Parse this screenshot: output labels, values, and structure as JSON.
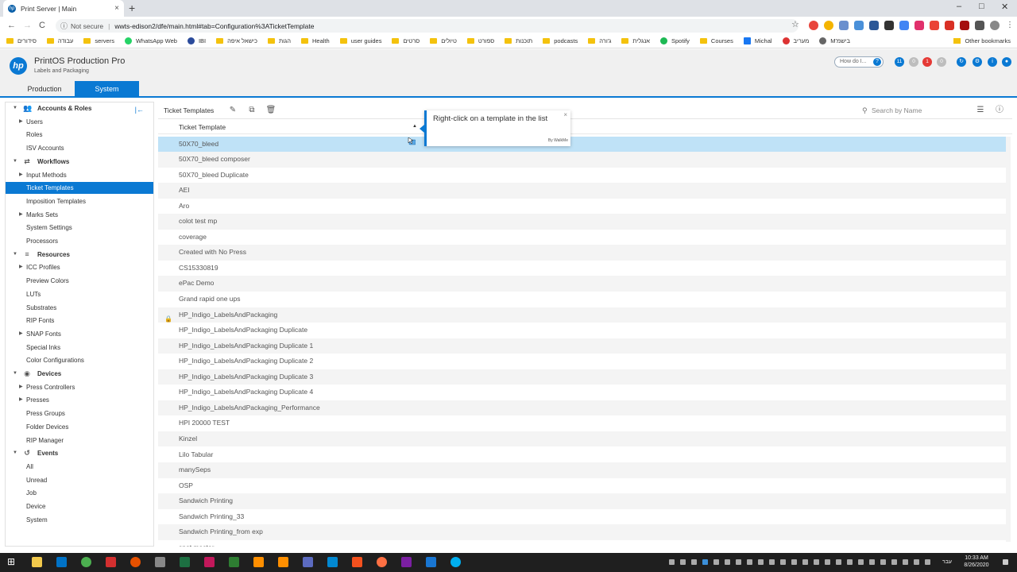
{
  "browser": {
    "tab_title": "Print Server | Main",
    "tab_favicon": "hp",
    "tab_close": "×",
    "new_tab": "+",
    "window_controls": [
      "–",
      "□",
      "✕"
    ],
    "security_label": "Not secure",
    "url": "wwts-edison2/dfe/main.html#tab=Configuration%3ATicketTemplate",
    "nav": [
      "←",
      "→",
      "C"
    ],
    "bookmark_star": "☆",
    "bookmarks": [
      "סידורים",
      "עבודה",
      "servers",
      "WhatsApp Web",
      "IBI",
      "כישאל איפה",
      "הגות",
      "Health",
      "user guides",
      "סרטים",
      "טיולים",
      "ספורט",
      "תוכנות",
      "podcasts",
      "ג'ורה",
      "אנגלית",
      "Spotify",
      "Courses",
      "Michal",
      "מעריב",
      "M'בישמ"
    ],
    "other_bookmarks": "Other bookmarks"
  },
  "app": {
    "logo": "hp",
    "title": "PrintOS Production Pro",
    "subtitle": "Labels and Packaging",
    "how_do_i": "How do I...",
    "help_glyph": "?",
    "badges": [
      {
        "count": "11",
        "color": "#0a79d3"
      },
      {
        "count": "0",
        "color": "#bdbdbd"
      },
      {
        "count": "1",
        "color": "#e53935"
      },
      {
        "count": "0",
        "color": "#bdbdbd"
      }
    ],
    "tabs": {
      "production": "Production",
      "system": "System"
    }
  },
  "sidebar": {
    "collapse_glyph": "|←",
    "items": [
      {
        "label": "Accounts & Roles",
        "type": "section",
        "icon": "users-icon",
        "glyph": "👥"
      },
      {
        "label": "Users",
        "type": "expandable"
      },
      {
        "label": "Roles",
        "type": "leaf"
      },
      {
        "label": "ISV Accounts",
        "type": "leaf"
      },
      {
        "label": "Workflows",
        "type": "section",
        "icon": "workflow-icon",
        "glyph": "⇄"
      },
      {
        "label": "Input Methods",
        "type": "expandable"
      },
      {
        "label": "Ticket Templates",
        "type": "leaf",
        "selected": true
      },
      {
        "label": "Imposition Templates",
        "type": "leaf"
      },
      {
        "label": "Marks Sets",
        "type": "expandable"
      },
      {
        "label": "System Settings",
        "type": "leaf"
      },
      {
        "label": "Processors",
        "type": "leaf"
      },
      {
        "label": "Resources",
        "type": "section",
        "icon": "database-icon",
        "glyph": "≡"
      },
      {
        "label": "ICC Profiles",
        "type": "expandable"
      },
      {
        "label": "Preview Colors",
        "type": "leaf"
      },
      {
        "label": "LUTs",
        "type": "leaf"
      },
      {
        "label": "Substrates",
        "type": "leaf"
      },
      {
        "label": "RIP Fonts",
        "type": "leaf"
      },
      {
        "label": "SNAP Fonts",
        "type": "expandable"
      },
      {
        "label": "Special Inks",
        "type": "leaf"
      },
      {
        "label": "Color Configurations",
        "type": "leaf"
      },
      {
        "label": "Devices",
        "type": "section",
        "icon": "devices-icon",
        "glyph": "◉"
      },
      {
        "label": "Press Controllers",
        "type": "expandable"
      },
      {
        "label": "Presses",
        "type": "expandable"
      },
      {
        "label": "Press Groups",
        "type": "leaf"
      },
      {
        "label": "Folder Devices",
        "type": "leaf"
      },
      {
        "label": "RIP Manager",
        "type": "leaf"
      },
      {
        "label": "Events",
        "type": "section",
        "icon": "history-icon",
        "glyph": "↺"
      },
      {
        "label": "All",
        "type": "leaf"
      },
      {
        "label": "Unread",
        "type": "leaf"
      },
      {
        "label": "Job",
        "type": "leaf"
      },
      {
        "label": "Device",
        "type": "leaf"
      },
      {
        "label": "System",
        "type": "leaf"
      }
    ]
  },
  "main": {
    "title": "Ticket Templates",
    "toolbar_glyphs": {
      "edit": "✎",
      "duplicate": "⧉",
      "delete": "🗑"
    },
    "search_placeholder": "Search by Name",
    "search_glyph": "⚲",
    "column_header": "Ticket Template",
    "rows": [
      {
        "name": "50X70_bleed",
        "selected": true
      },
      {
        "name": "50X70_bleed composer"
      },
      {
        "name": "50X70_bleed Duplicate"
      },
      {
        "name": "AEI"
      },
      {
        "name": "Aro"
      },
      {
        "name": "colot test mp"
      },
      {
        "name": "coverage"
      },
      {
        "name": "Created with No Press"
      },
      {
        "name": "CS15330819"
      },
      {
        "name": "ePac Demo"
      },
      {
        "name": "Grand rapid one ups"
      },
      {
        "name": "HP_Indigo_LabelsAndPackaging",
        "locked": true
      },
      {
        "name": "HP_Indigo_LabelsAndPackaging Duplicate"
      },
      {
        "name": "HP_Indigo_LabelsAndPackaging Duplicate 1"
      },
      {
        "name": "HP_Indigo_LabelsAndPackaging Duplicate 2"
      },
      {
        "name": "HP_Indigo_LabelsAndPackaging Duplicate 3"
      },
      {
        "name": "HP_Indigo_LabelsAndPackaging Duplicate 4"
      },
      {
        "name": "HP_Indigo_LabelsAndPackaging_Performance"
      },
      {
        "name": "HPI 20000 TEST"
      },
      {
        "name": "Kinzel"
      },
      {
        "name": "Lilo Tabular"
      },
      {
        "name": "manySeps"
      },
      {
        "name": "OSP"
      },
      {
        "name": "Sandwich Printing"
      },
      {
        "name": "Sandwich Printing_33"
      },
      {
        "name": "Sandwich Printing_from exp"
      },
      {
        "name": "spot master"
      }
    ]
  },
  "tooltip": {
    "text": "Right-click on a template in the list",
    "brand": "By WalkMe",
    "close_glyph": "×"
  },
  "taskbar": {
    "start_glyph": "⊞",
    "language": "עבר",
    "time": "10:33 AM",
    "date": "8/26/2020"
  },
  "colors": {
    "accent": "#0a79d3",
    "selected_row": "#bfe2f7",
    "alert": "#e53935"
  }
}
